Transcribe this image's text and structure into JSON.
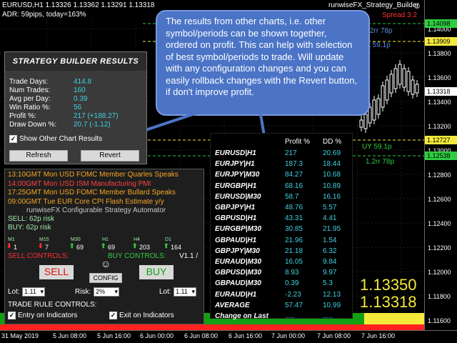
{
  "chart": {
    "symbol_line": "EURUSD,H1  1.13326 1.13362 1.13291 1.13318",
    "adr_line": "ADR: 59pips, today=163%",
    "indicator_title": "runwiseFX_Strategy_Builder",
    "smiley": "☺",
    "spread": "Spread 3.2",
    "ghost_buy": "p BUY 1.2rr 78p",
    "ghost_sell": "ial SELL 59.1p",
    "ghost_buy2": "UY 59.1p",
    "ghost_buy3": "1.2rr 78p",
    "price_labels": [
      "1.14000",
      "1.13800",
      "1.13600",
      "1.13400",
      "1.13200",
      "1.13000",
      "1.12800",
      "1.12600",
      "1.12400",
      "1.12200",
      "1.12000",
      "1.11800",
      "1.11600"
    ],
    "price_tags": [
      {
        "text": "1.14098",
        "color": "#2ecc40"
      },
      {
        "text": "1.13909",
        "color": "#f5ea3c"
      },
      {
        "text": "1.13318",
        "color": "#ffffff"
      },
      {
        "text": "1.12727",
        "color": "#f5ea3c"
      },
      {
        "text": "1.12538",
        "color": "#2ecc40"
      }
    ],
    "time_labels": [
      "31 May 2019",
      "5 Jun 08:00",
      "5 Jun 16:00",
      "6 Jun 00:00",
      "6 Jun 08:00",
      "6 Jun 16:00",
      "7 Jun 00:00",
      "7 Jun 08:00",
      "7 Jun 16:00"
    ],
    "big_bid": "1.13350",
    "big_ask": "1.13318"
  },
  "callout": {
    "text": "The results from other charts, i.e. other symbol/periods can be shown together, ordered on profit. This can help with selection of best symbol/periods to trade. Will update with any configuration changes and you can easily rollback changes with the Revert button, if don't improve profit."
  },
  "strategy_builder": {
    "title": "STRATEGY BUILDER RESULTS",
    "rows": [
      {
        "label": "Trade Days:",
        "value": "414.8"
      },
      {
        "label": "Num Trades:",
        "value": "160"
      },
      {
        "label": "Avg per Day:",
        "value": "0.39"
      },
      {
        "label": "Win Ratio %:",
        "value": "56"
      },
      {
        "label": "Profit %:",
        "value": "217 (+188.27)"
      },
      {
        "label": "Draw Down %:",
        "value": "20.7 (-1.12)"
      }
    ],
    "show_other_label": "Show Other Chart Results",
    "check_mark": "✓",
    "refresh_label": "Refresh",
    "revert_label": "Revert"
  },
  "results": {
    "header_profit": "Profit %",
    "header_dd": "DD %",
    "rows": [
      {
        "symbol": "EURUSD|H1",
        "profit": "217",
        "dd": "20.69"
      },
      {
        "symbol": "EURJPY|H1",
        "profit": "187.3",
        "dd": "18.44"
      },
      {
        "symbol": "EURJPY|M30",
        "profit": "84.27",
        "dd": "10.68"
      },
      {
        "symbol": "EURGBP|H1",
        "profit": "68.16",
        "dd": "10.89"
      },
      {
        "symbol": "EURUSD|M30",
        "profit": "58.7",
        "dd": "16.16"
      },
      {
        "symbol": "GBPJPY|H1",
        "profit": "48.76",
        "dd": "5.57"
      },
      {
        "symbol": "GBPUSD|H1",
        "profit": "43.31",
        "dd": "4.41"
      },
      {
        "symbol": "EURGBP|M30",
        "profit": "30.85",
        "dd": "21.95"
      },
      {
        "symbol": "GBPAUD|H1",
        "profit": "21.96",
        "dd": "1.54"
      },
      {
        "symbol": "GBPJPY|M30",
        "profit": "21.18",
        "dd": "6.32"
      },
      {
        "symbol": "EURAUD|M30",
        "profit": "16.05",
        "dd": "9.84"
      },
      {
        "symbol": "GBPUSD|M30",
        "profit": "8.93",
        "dd": "9.97"
      },
      {
        "symbol": "GBPAUD|M30",
        "profit": "0.39",
        "dd": "5.3"
      },
      {
        "symbol": "EURAUD|H1",
        "profit": "-2.23",
        "dd": "12.13"
      },
      {
        "symbol": "AVERAGE",
        "profit": "57.47",
        "dd": "10.99"
      },
      {
        "symbol": "Change on Last",
        "profit": ".....",
        "dd": "....."
      }
    ]
  },
  "automator": {
    "news": [
      {
        "text": "13:10GMT Mon USD FOMC Member Quarles Speaks",
        "color": "#f5a623"
      },
      {
        "text": "14:00GMT Mon USD ISM Manufacturing PMI",
        "color": "#ff4040"
      },
      {
        "text": "17:25GMT Mon USD FOMC Member Bullard Speaks",
        "color": "#f5a623"
      },
      {
        "text": "09:00GMT Tue EUR Core CPI Flash Estimate y/y",
        "color": "#f5a623"
      }
    ],
    "title": "runwiseFX Configurable Strategy Automator",
    "sell_risk": "SELL: 62p risk",
    "buy_risk": "BUY: 62p risk",
    "timeframes": [
      {
        "tf": "M1",
        "value": "1",
        "dir": "down"
      },
      {
        "tf": "M15",
        "value": "7",
        "dir": "down"
      },
      {
        "tf": "M30",
        "value": "69",
        "dir": "up"
      },
      {
        "tf": "H1",
        "value": "69",
        "dir": "up"
      },
      {
        "tf": "H4",
        "value": "203",
        "dir": "up"
      },
      {
        "tf": "D1",
        "value": "164",
        "dir": "up"
      }
    ],
    "sell_controls": "SELL CONTROLS:",
    "buy_controls": "BUY CONTROLS:",
    "version": "V1.1 /",
    "sell_button": "SELL",
    "buy_button": "BUY",
    "config_button": "CONFIG",
    "config_smiley": "☺",
    "lot_label": "Lot:",
    "lot_sell_value": "1.11",
    "lot_buy_value": "1.11",
    "risk_label": "Risk:",
    "risk_value": "2%",
    "trade_rule_controls": "TRADE RULE CONTROLS:",
    "entry_label": "Entry on Indicators",
    "exit_label": "Exit on Indicators",
    "check_mark": "✓",
    "dropdown_arrow": "▾"
  }
}
